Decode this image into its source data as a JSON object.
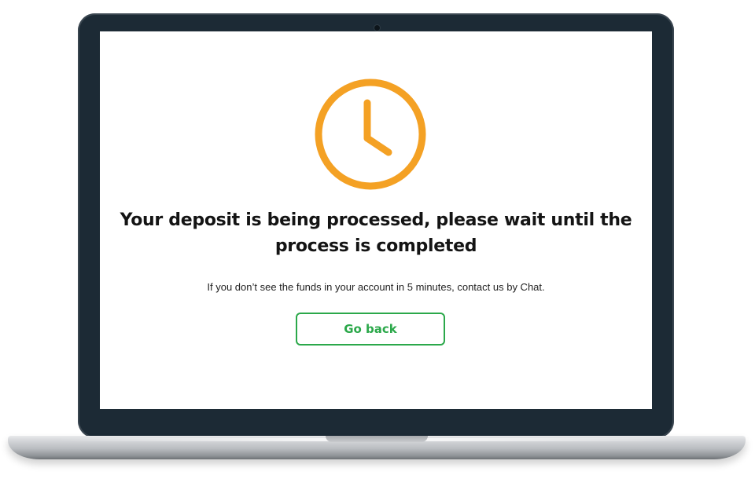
{
  "device": {
    "frame_color": "#1c2a35",
    "base_color": "#c2c4c7"
  },
  "status": {
    "icon": "clock-icon",
    "icon_color": "#f4a124",
    "heading": "Your deposit is being processed, please wait until the process is completed",
    "message": "If you don’t see the funds in your account in 5 minutes, contact us by Chat."
  },
  "actions": {
    "go_back_label": "Go back",
    "accent_color": "#2ba84a"
  }
}
